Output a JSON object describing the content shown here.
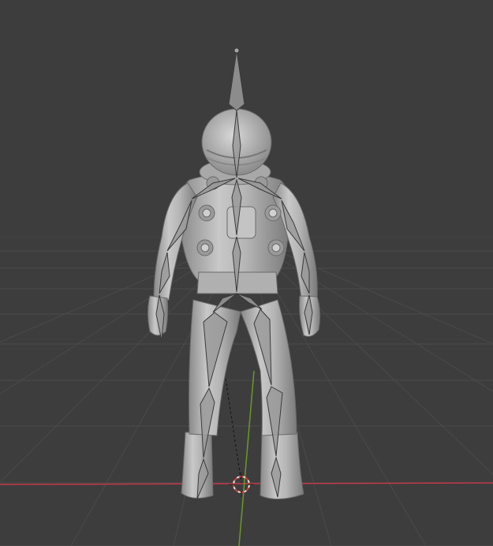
{
  "viewport": {
    "background": "#3d3d3d",
    "grid_color": "#4a4a4a",
    "x_axis_color": "#c3394a",
    "y_axis_color": "#6a9a2a",
    "origin_icon": "3d-cursor-icon",
    "model_icon": "astronaut-model-icon",
    "armature_icon": "armature-bones-icon"
  }
}
